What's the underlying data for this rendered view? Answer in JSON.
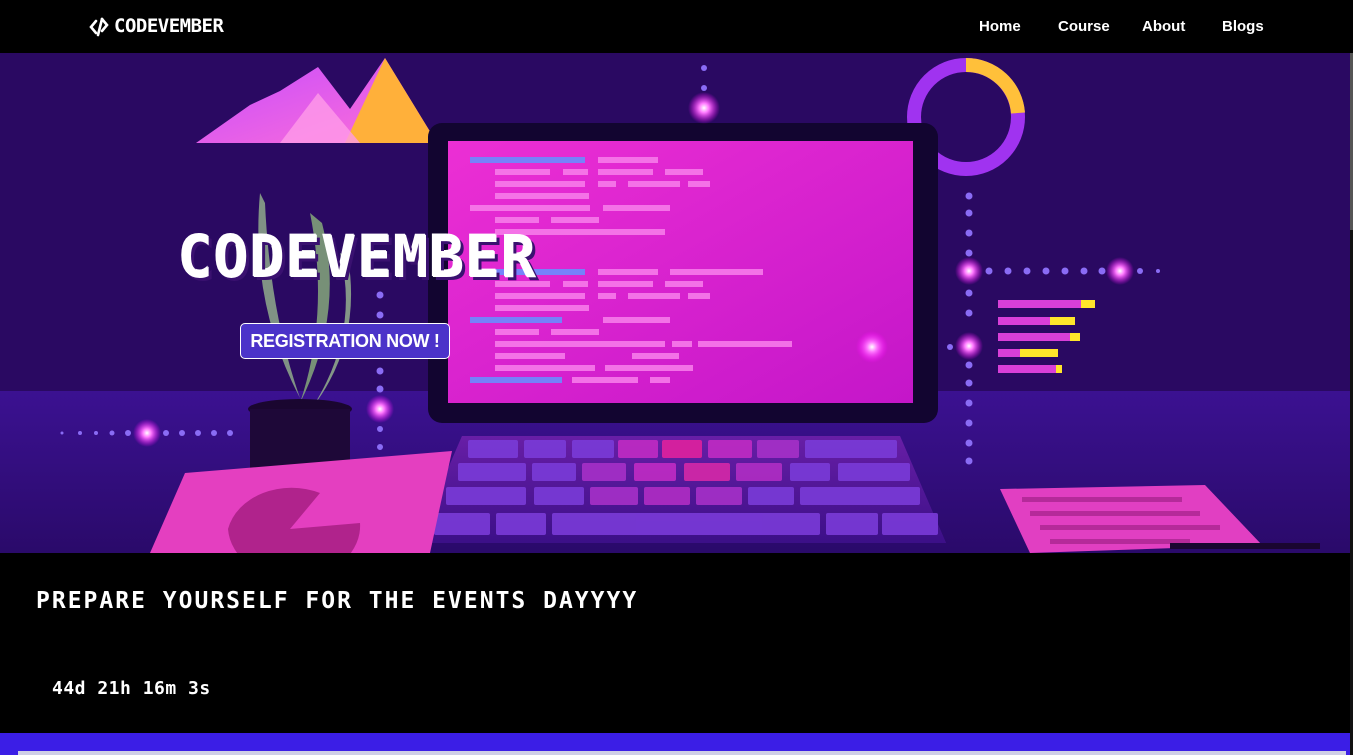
{
  "navbar": {
    "logo_text": "CODEVEMBER",
    "links": [
      {
        "label": "Home"
      },
      {
        "label": "Course"
      },
      {
        "label": "About"
      },
      {
        "label": "Blogs"
      }
    ]
  },
  "hero": {
    "title": "CODEVEMBER",
    "cta_label": "REGISTRATION NOW !"
  },
  "countdown_section": {
    "heading": "PREPARE YOURSELF FOR THE EVENTS DAYYYY",
    "timer": "44d 21h 16m 3s"
  },
  "colors": {
    "accent": "#4b33c9",
    "bottom_bar": "#3b1ee6",
    "screen_pink": "#e11fd0"
  }
}
